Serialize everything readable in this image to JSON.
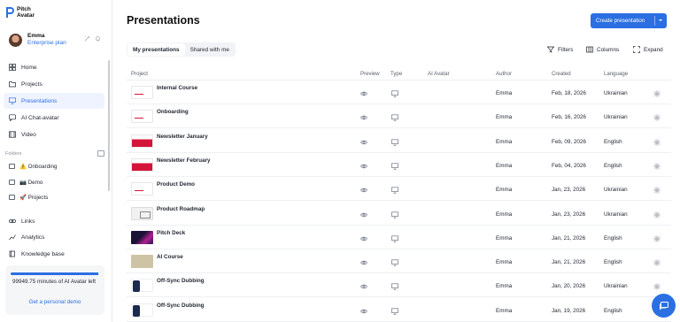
{
  "app": {
    "logo_line1": "Pitch",
    "logo_line2": "Avatar",
    "brand_color": "#2b6fe3"
  },
  "user": {
    "name": "Emma",
    "plan": "Enterprise plan"
  },
  "sidebar": {
    "nav": [
      {
        "label": "Home",
        "icon": "grid-icon"
      },
      {
        "label": "Projects",
        "icon": "folder-icon"
      },
      {
        "label": "Presentations",
        "icon": "monitor-icon",
        "active": true
      },
      {
        "label": "AI Chat-avatar",
        "icon": "chat-avatar-icon"
      },
      {
        "label": "Video",
        "icon": "film-icon"
      }
    ],
    "folders_label": "Folders",
    "folders": [
      {
        "label": "⚠️ Onboarding"
      },
      {
        "label": "📷 Demo"
      },
      {
        "label": "🚀 Projects"
      }
    ],
    "bottom_nav": [
      {
        "label": "Links",
        "icon": "link-icon"
      },
      {
        "label": "Analytics",
        "icon": "analytics-icon"
      },
      {
        "label": "Knowledge base",
        "icon": "book-icon"
      }
    ],
    "minutes": {
      "text": "99949.75 minutes of AI Avatar left",
      "remaining_fraction": 0.99,
      "link": "Get a personal demo"
    }
  },
  "main": {
    "title": "Presentations",
    "create_button": "Create presentation",
    "tabs": [
      {
        "label": "My presentations",
        "active": true
      },
      {
        "label": "Shared with me",
        "active": false
      }
    ],
    "toolbar": {
      "filters": "Filters",
      "columns": "Columns",
      "expand": "Expand"
    },
    "columns": [
      "Project",
      "Preview",
      "Type",
      "AI Avatar",
      "Author",
      "Created",
      "Language"
    ],
    "rows": [
      {
        "name": "Internal Course",
        "author": "Emma",
        "created": "Feb, 18, 2026",
        "language": "Ukrainian",
        "thumb": "white"
      },
      {
        "name": "Onboarding",
        "author": "Emma",
        "created": "Feb, 16, 2026",
        "language": "Ukrainian",
        "thumb": "white"
      },
      {
        "name": "Newsletter January",
        "author": "Emma",
        "created": "Feb, 09, 2026",
        "language": "English",
        "thumb": "red"
      },
      {
        "name": "Newsletter February",
        "author": "Emma",
        "created": "Feb, 04, 2026",
        "language": "English",
        "thumb": "red"
      },
      {
        "name": "Product Demo",
        "author": "Emma",
        "created": "Jan, 23, 2026",
        "language": "Ukrainian",
        "thumb": "white"
      },
      {
        "name": "Product Roadmap",
        "author": "Emma",
        "created": "Jan, 23, 2026",
        "language": "Ukrainian",
        "thumb": "sketch"
      },
      {
        "name": "Pitch Deck",
        "author": "Emma",
        "created": "Jan, 21, 2026",
        "language": "English",
        "thumb": "dark"
      },
      {
        "name": "AI Course",
        "author": "Emma",
        "created": "Jan, 21, 2026",
        "language": "English",
        "thumb": "beige"
      },
      {
        "name": "Off-Sync Dubbing",
        "author": "Emma",
        "created": "Jan, 20, 2026",
        "language": "Ukrainian",
        "thumb": "phone"
      },
      {
        "name": "Off-Sync Dubbing",
        "author": "Emma",
        "created": "Jan, 19, 2026",
        "language": "English",
        "thumb": "phone"
      }
    ]
  }
}
